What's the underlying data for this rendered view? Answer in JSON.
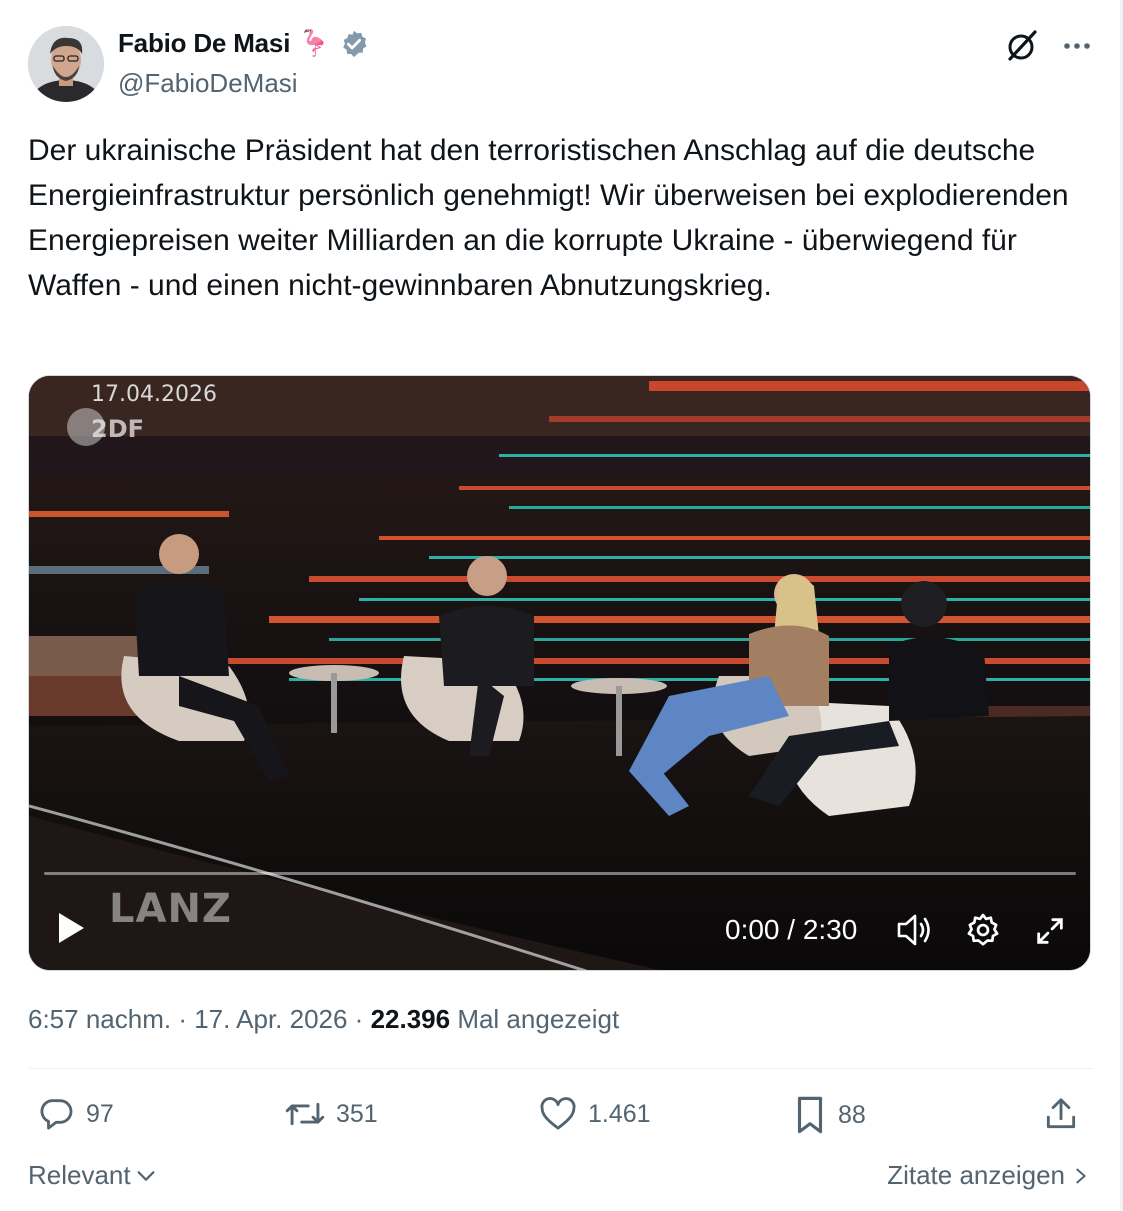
{
  "author": {
    "display_name": "Fabio De Masi",
    "emoji": "🦩",
    "handle": "@FabioDeMasi",
    "verified": true
  },
  "tweet": {
    "text": "Der ukrainische Präsident hat den terroristischen Anschlag auf die deutsche Energieinfrastruktur persönlich genehmigt! Wir überweisen bei explodierenden Energiepreisen weiter Milliarden an die korrupte Ukraine - überwiegend für Waffen - und einen nicht-gewinnbaren Abnutzungskrieg."
  },
  "video": {
    "date_overlay": "17.04.2026",
    "channel_logo": "2DF",
    "show_name": "LANZ",
    "time": "0:00 / 2:30"
  },
  "meta": {
    "time": "6:57 nachm.",
    "sep1": " · ",
    "date": "17. Apr. 2026",
    "sep2": " · ",
    "views": "22.396",
    "views_label": " Mal angezeigt"
  },
  "actions": {
    "replies": "97",
    "reposts": "351",
    "likes": "1.461",
    "bookmarks": "88"
  },
  "footer": {
    "sort_label": "Relevant",
    "quotes_label": "Zitate anzeigen"
  },
  "colors": {
    "text_primary": "#0f1419",
    "text_secondary": "#536471",
    "verified_badge": "#829aab",
    "divider": "#eff3f4"
  },
  "icons": [
    "verified-badge-icon",
    "grok-icon",
    "more-icon",
    "play-icon",
    "volume-icon",
    "settings-icon",
    "fullscreen-icon",
    "reply-icon",
    "repost-icon",
    "like-icon",
    "bookmark-icon",
    "share-icon",
    "chevron-down-icon",
    "chevron-right-icon"
  ]
}
